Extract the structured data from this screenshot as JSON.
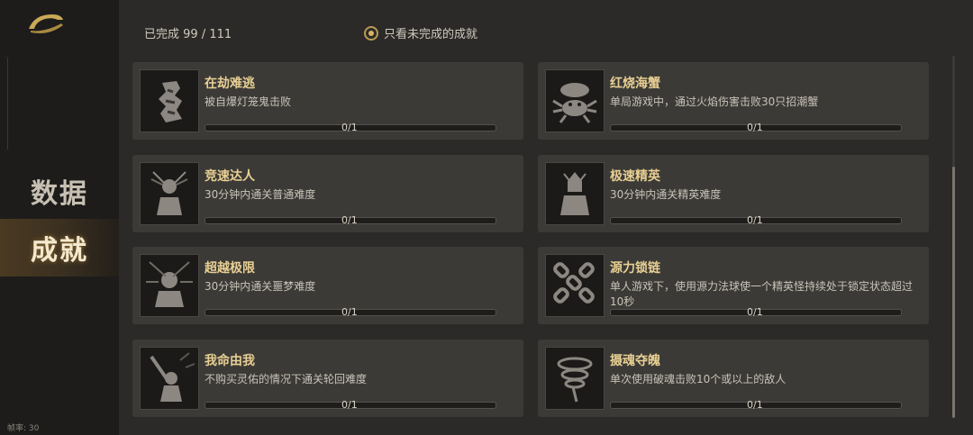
{
  "nav": {
    "items": [
      {
        "label": "数据"
      },
      {
        "label": "成就"
      }
    ]
  },
  "fps_label": "帧率: 30",
  "summary": "已完成 99 / 111",
  "filter_label": "只看未完成的成就",
  "accent_color": "#e8cf93",
  "achievements": [
    {
      "title": "在劫难逃",
      "desc": "被自爆灯笼鬼击败",
      "progress": "0/1",
      "icon": "lantern-ghost-icon"
    },
    {
      "title": "红烧海蟹",
      "desc": "单局游戏中，通过火焰伤害击败30只招潮蟹",
      "progress": "0/1",
      "icon": "crab-icon"
    },
    {
      "title": "竞速达人",
      "desc": "30分钟内通关普通难度",
      "progress": "0/1",
      "icon": "warrior-icon"
    },
    {
      "title": "极速精英",
      "desc": "30分钟内通关精英难度",
      "progress": "0/1",
      "icon": "warrior-elite-icon"
    },
    {
      "title": "超越极限",
      "desc": "30分钟内通关噩梦难度",
      "progress": "0/1",
      "icon": "warrior-nightmare-icon"
    },
    {
      "title": "源力锁链",
      "desc": "单人游戏下，使用源力法球使一个精英怪持续处于锁定状态超过10秒",
      "progress": "0/1",
      "icon": "chain-icon"
    },
    {
      "title": "我命由我",
      "desc": "不购买灵佑的情况下通关轮回难度",
      "progress": "0/1",
      "icon": "raised-sword-icon"
    },
    {
      "title": "摄魂夺魄",
      "desc": "单次使用破魂击败10个或以上的敌人",
      "progress": "0/1",
      "icon": "vortex-icon"
    }
  ]
}
